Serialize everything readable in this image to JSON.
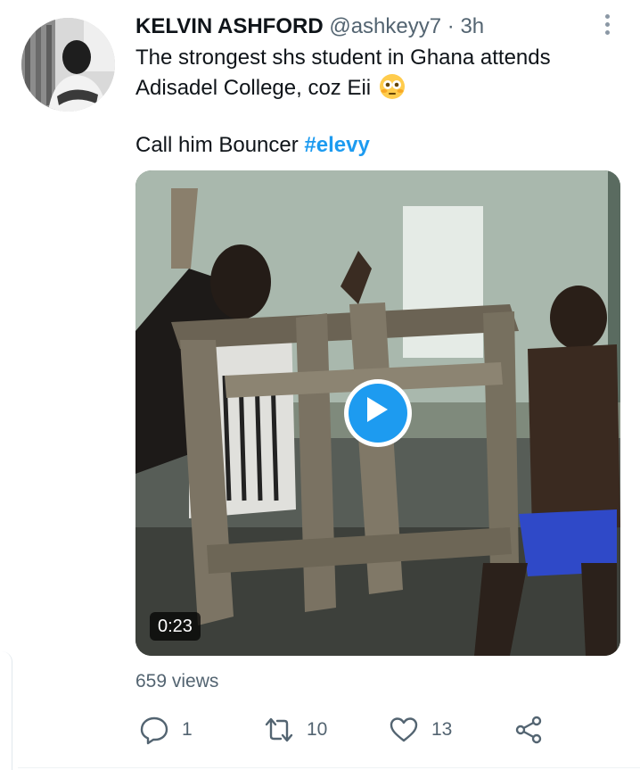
{
  "author": {
    "name": "KELVIN ASHFORD",
    "handle": "@ashkeyy7",
    "separator": "·",
    "time": "3h"
  },
  "tweet": {
    "line1": "The strongest shs student in Ghana attends",
    "line2": "Adisadel College, coz Eii",
    "line3": "Call him Bouncer",
    "hashtag": "#elevy",
    "emoji": "flushed-face-emoji"
  },
  "media": {
    "duration": "0:23"
  },
  "stats": {
    "views": "659 views"
  },
  "actions": {
    "reply_count": "1",
    "retweet_count": "10",
    "like_count": "13"
  },
  "icons": {
    "more": "more-dots-icon",
    "reply": "reply-icon",
    "retweet": "retweet-icon",
    "like": "heart-icon",
    "share": "share-icon",
    "play": "play-icon"
  },
  "colors": {
    "accent": "#1d9bf0",
    "text": "#0f1419",
    "muted": "#536471"
  }
}
